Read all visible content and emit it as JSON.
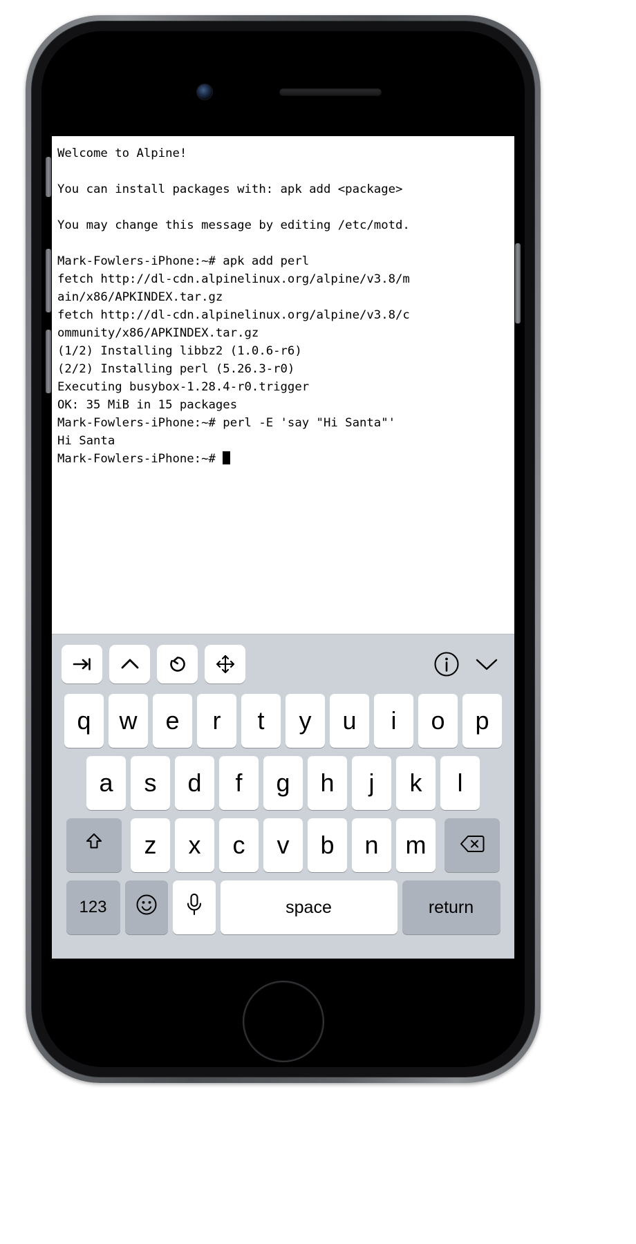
{
  "device": {
    "name": "iPhone",
    "color_name": "space-gray",
    "frame_color": "#6f7276",
    "screen_bg": "#ffffff"
  },
  "terminal": {
    "app": "Alpine Linux shell",
    "fg_color": "#000000",
    "bg_color": "#ffffff",
    "prompt": "Mark-Fowlers-iPhone:~#",
    "lines": [
      "Welcome to Alpine!",
      "",
      "You can install packages with: apk add <package>",
      "",
      "You may change this message by editing /etc/motd.",
      "",
      "Mark-Fowlers-iPhone:~# apk add perl",
      "fetch http://dl-cdn.alpinelinux.org/alpine/v3.8/m",
      "ain/x86/APKINDEX.tar.gz",
      "fetch http://dl-cdn.alpinelinux.org/alpine/v3.8/c",
      "ommunity/x86/APKINDEX.tar.gz",
      "(1/2) Installing libbz2 (1.0.6-r6)",
      "(2/2) Installing perl (5.26.3-r0)",
      "Executing busybox-1.28.4-r0.trigger",
      "OK: 35 MiB in 15 packages",
      "Mark-Fowlers-iPhone:~# perl -E 'say \"Hi Santa\"'",
      "Hi Santa"
    ],
    "last_prompt": "Mark-Fowlers-iPhone:~# "
  },
  "keyboard": {
    "bg_color": "#cdd1d8",
    "key_color": "#ffffff",
    "modifier_key_color": "#adb3bd",
    "toolbar": {
      "keys": [
        {
          "name": "tab-key",
          "icon": "tab-arrow-icon",
          "label": "tab"
        },
        {
          "name": "ctrl-key",
          "icon": "caret-up-icon",
          "label": "ctrl"
        },
        {
          "name": "history-key",
          "icon": "rotate-ccw-icon",
          "label": "history"
        },
        {
          "name": "arrows-key",
          "icon": "four-way-arrows-icon",
          "label": "arrows"
        }
      ],
      "right_keys": [
        {
          "name": "info-button",
          "icon": "info-circle-icon",
          "label": "info"
        },
        {
          "name": "dismiss-keyboard-button",
          "icon": "chevron-down-icon",
          "label": "hide keyboard"
        }
      ]
    },
    "row1": [
      "q",
      "w",
      "e",
      "r",
      "t",
      "y",
      "u",
      "i",
      "o",
      "p"
    ],
    "row2": [
      "a",
      "s",
      "d",
      "f",
      "g",
      "h",
      "j",
      "k",
      "l"
    ],
    "row3": [
      "z",
      "x",
      "c",
      "v",
      "b",
      "n",
      "m"
    ],
    "shift_label": "shift",
    "delete_label": "delete",
    "row4": {
      "numbers_label": "123",
      "emoji_label": "emoji",
      "dictation_label": "dictation",
      "space_label": "space",
      "return_label": "return"
    }
  }
}
